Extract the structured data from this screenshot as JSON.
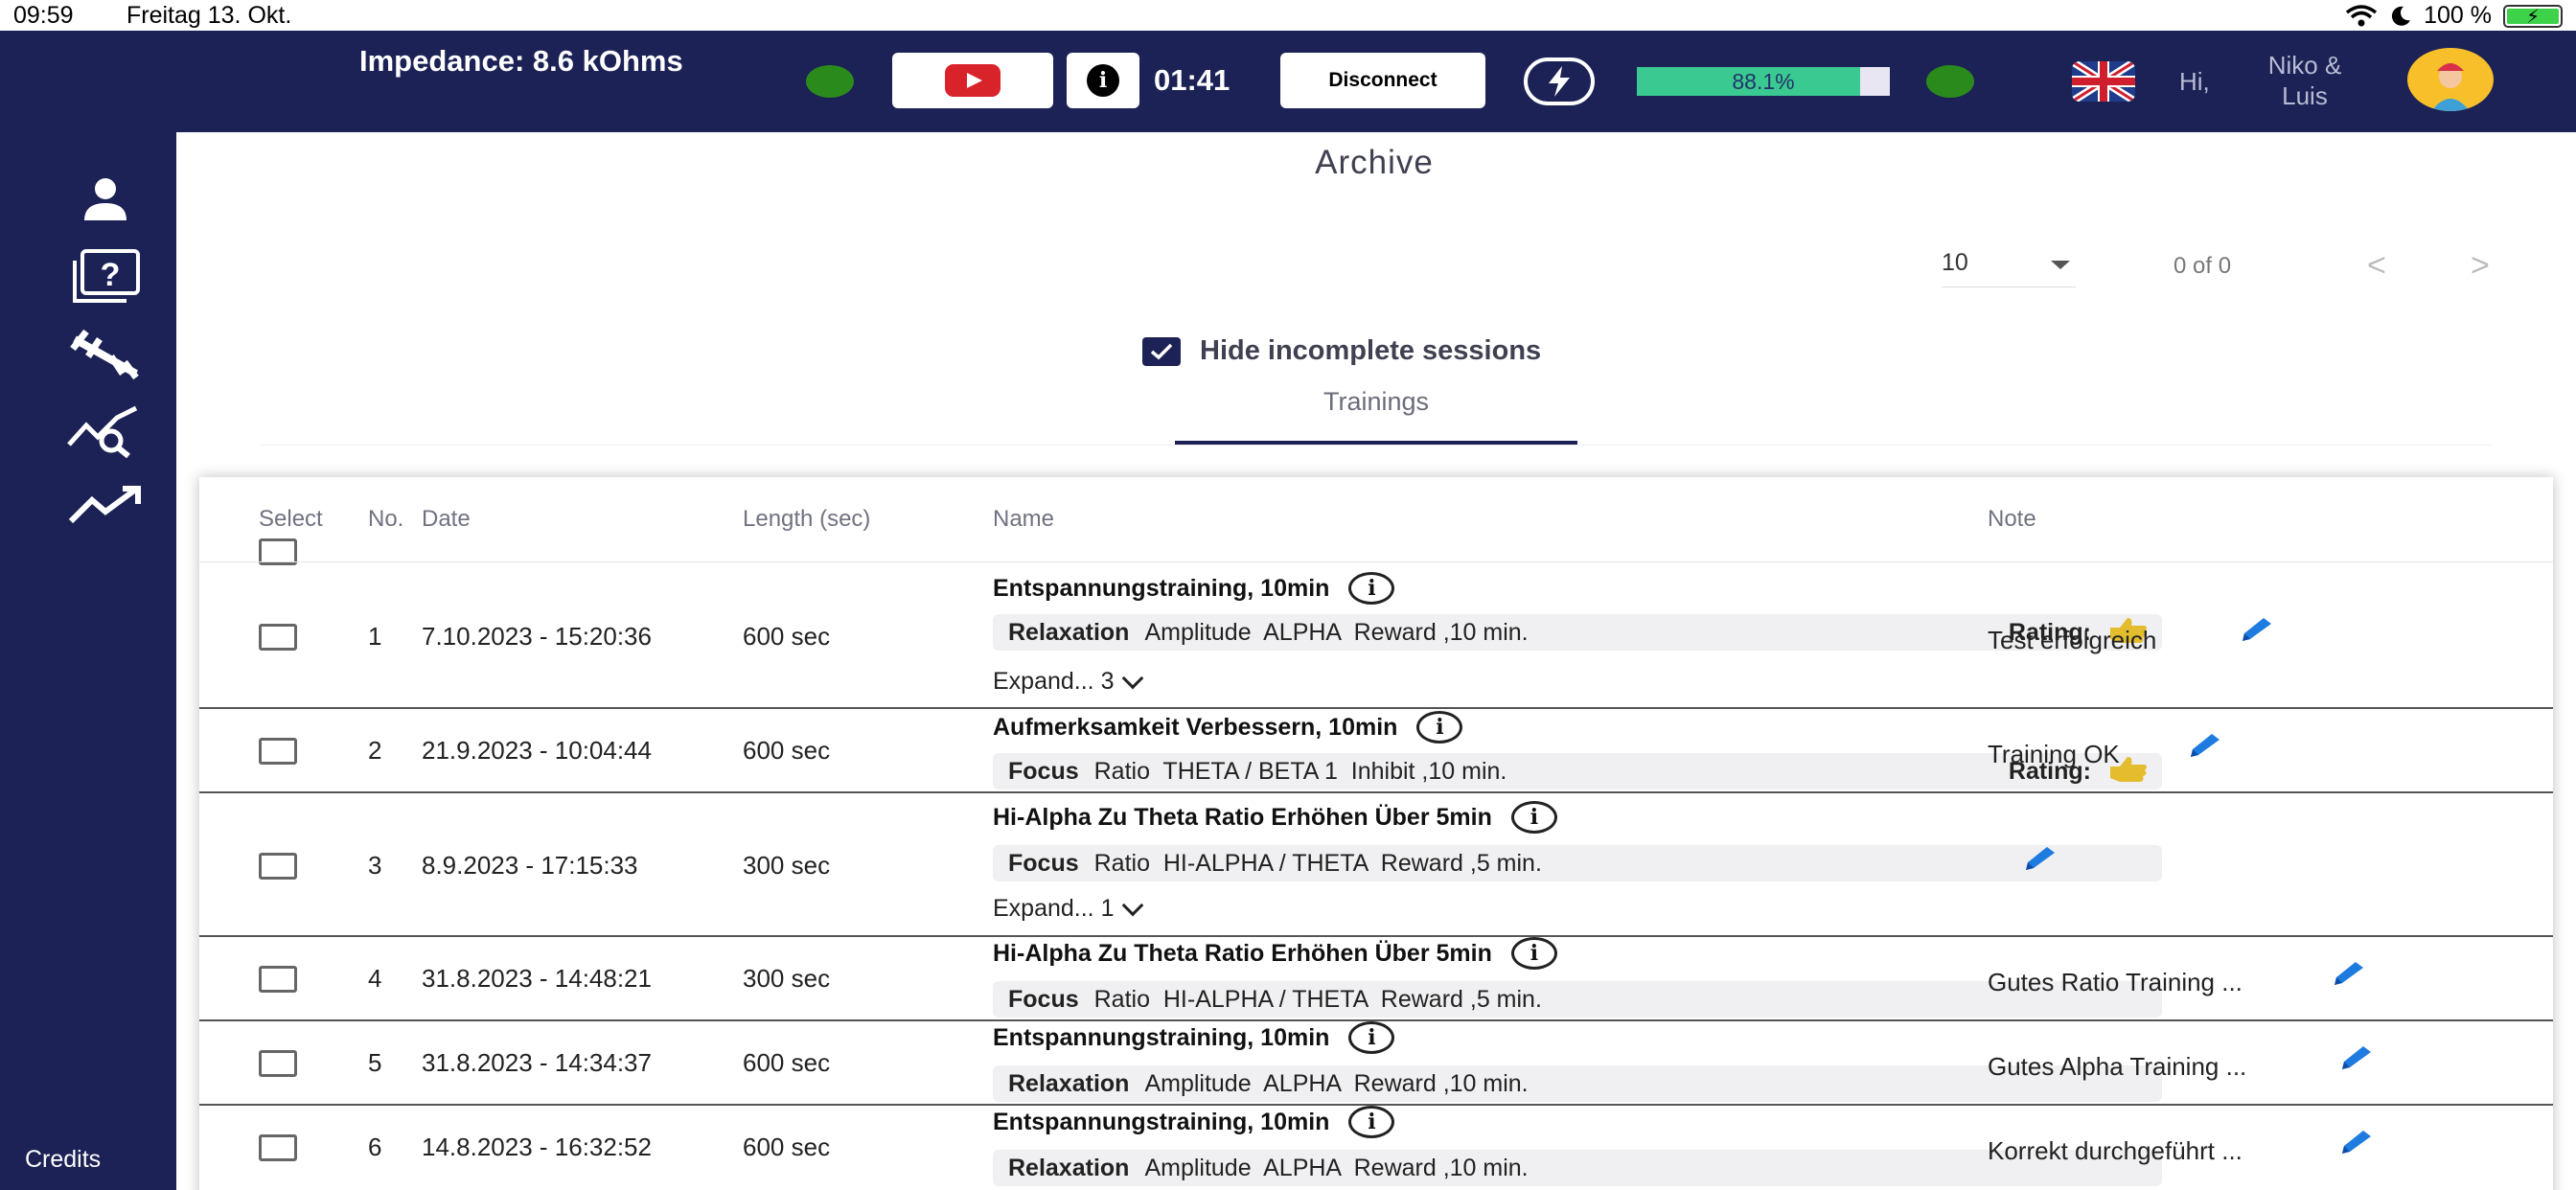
{
  "status_bar": {
    "time": "09:59",
    "date": "Freitag 13. Okt.",
    "battery": "100 %"
  },
  "header": {
    "impedance": "Impedance: 8.6 kOhms",
    "timer": "01:41",
    "disconnect_label": "Disconnect",
    "progress_label": "88.1%",
    "progress_value": 0.881,
    "greeting": "Hi,",
    "username": "Niko & Luis",
    "colors": {
      "bg": "#1c2255",
      "status_dot": "#2b8a1c",
      "progress": "#3ac990"
    }
  },
  "sidebar": {
    "icons": [
      "person-icon",
      "quiz-icon",
      "training-tools-icon",
      "analysis-icon",
      "trend-icon"
    ],
    "credits": "Credits"
  },
  "main": {
    "title": "Archive",
    "page_size": "10",
    "page_count": "0 of 0",
    "hide_incomplete_label": "Hide incomplete sessions",
    "tab_label": "Trainings"
  },
  "table": {
    "headers": {
      "select": "Select",
      "no": "No.",
      "date": "Date",
      "length": "Length (sec)",
      "name": "Name",
      "note": "Note"
    },
    "rating_label": "Rating:",
    "rows": [
      {
        "no": "1",
        "date": "7.10.2023 - 15:20:36",
        "length": "600 sec",
        "name": "Entspannungstraining, 10min",
        "type": "Relaxation",
        "detail": "Amplitude  ALPHA  Reward ,10 min.",
        "rating": true,
        "expand": "Expand... 3",
        "note": "Test erfolgreich"
      },
      {
        "no": "2",
        "date": "21.9.2023 - 10:04:44",
        "length": "600 sec",
        "name": "Aufmerksamkeit Verbessern, 10min",
        "type": "Focus",
        "detail": "Ratio  THETA / BETA 1  Inhibit ,10 min.",
        "rating": true,
        "expand": "",
        "note": "Training OK"
      },
      {
        "no": "3",
        "date": "8.9.2023 - 17:15:33",
        "length": "300 sec",
        "name": "Hi-Alpha Zu Theta Ratio Erhöhen Über 5min",
        "type": "Focus",
        "detail": "Ratio  HI-ALPHA / THETA  Reward ,5 min.",
        "rating": false,
        "expand": "Expand... 1",
        "note": ""
      },
      {
        "no": "4",
        "date": "31.8.2023 - 14:48:21",
        "length": "300 sec",
        "name": "Hi-Alpha Zu Theta Ratio Erhöhen Über 5min",
        "type": "Focus",
        "detail": "Ratio  HI-ALPHA / THETA  Reward ,5 min.",
        "rating": false,
        "expand": "",
        "note": "Gutes Ratio Training ..."
      },
      {
        "no": "5",
        "date": "31.8.2023 - 14:34:37",
        "length": "600 sec",
        "name": "Entspannungstraining, 10min",
        "type": "Relaxation",
        "detail": "Amplitude  ALPHA  Reward ,10 min.",
        "rating": false,
        "expand": "",
        "note": "Gutes Alpha Training ..."
      },
      {
        "no": "6",
        "date": "14.8.2023 - 16:32:52",
        "length": "600 sec",
        "name": "Entspannungstraining, 10min",
        "type": "Relaxation",
        "detail": "Amplitude  ALPHA  Reward ,10 min.",
        "rating": false,
        "expand": "",
        "note": "Korrekt durchgeführt ..."
      }
    ]
  }
}
